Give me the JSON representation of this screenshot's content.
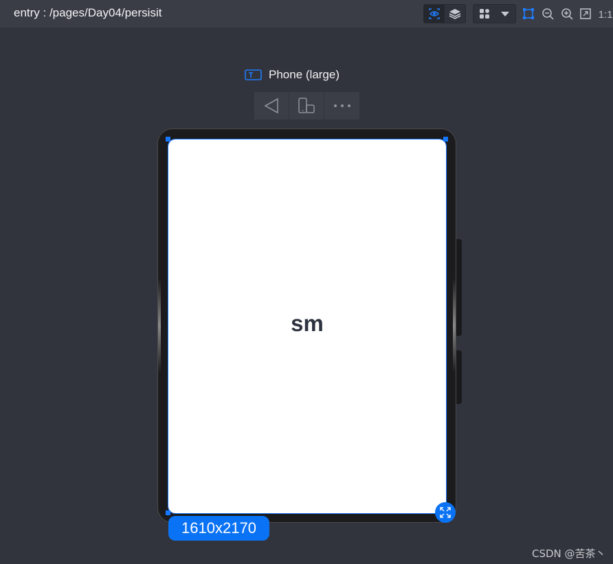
{
  "header": {
    "route": "entry : /pages/Day04/persisit",
    "ratio_label": "1:1"
  },
  "toolbar": {
    "icons": [
      "eye-inspect-icon",
      "layers-icon",
      "grid-apps-icon",
      "caret-down-icon",
      "select-frame-icon",
      "zoom-out-icon",
      "zoom-in-icon",
      "fit-screen-icon"
    ]
  },
  "device": {
    "label": "Phone (large)",
    "controls": [
      "back-icon",
      "rotate-device-icon",
      "more-icon"
    ]
  },
  "screen": {
    "text": "sm",
    "resolution": "1610x2170"
  },
  "watermark": "CSDN @苦茶丶",
  "colors": {
    "accent": "#0a73f5",
    "background": "#31343c",
    "topbar": "#3a3d46"
  }
}
